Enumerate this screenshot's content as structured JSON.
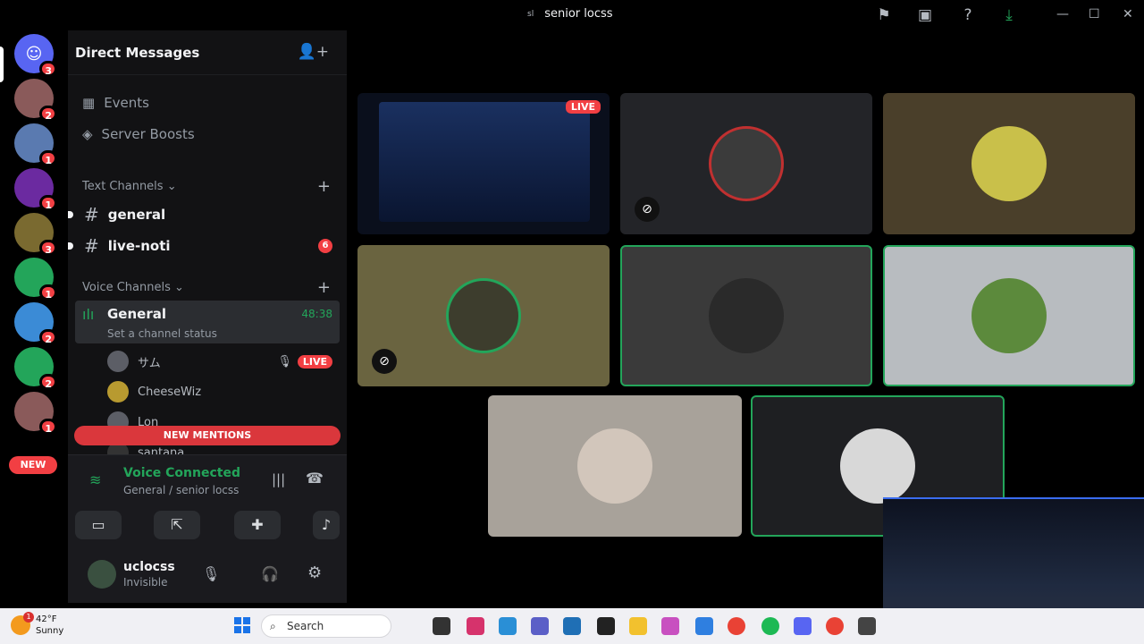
{
  "window": {
    "title": "senior locss",
    "server_abbrev": "sl",
    "minimize": "—",
    "maximize": "☐",
    "close": "✕"
  },
  "rail": {
    "dm_badge": "3",
    "servers": [
      {
        "badge": "2",
        "color": "#8a5a5a"
      },
      {
        "badge": "1",
        "color": "#5a7ab0"
      },
      {
        "badge": "1",
        "color": "#6b2aa0"
      },
      {
        "badge": "3",
        "color": "#7a6a30"
      },
      {
        "badge": "1",
        "color": "#23a55a"
      },
      {
        "badge": "2",
        "color": "#3b8bd6"
      },
      {
        "badge": "2",
        "color": "#23a55a"
      },
      {
        "badge": "1",
        "color": "#8a5a5a"
      }
    ],
    "new_label": "NEW"
  },
  "sidebar": {
    "header": "Direct Messages",
    "events": "Events",
    "boosts": "Server Boosts",
    "text_category": "Text Channels",
    "text_channels": [
      {
        "name": "general",
        "unread": ""
      },
      {
        "name": "live-noti",
        "unread": "6"
      }
    ],
    "voice_category": "Voice Channels",
    "voice_channel": {
      "name": "General",
      "time": "48:38",
      "status": "Set a channel status"
    },
    "voice_users": [
      {
        "name": "サム",
        "live": "LIVE"
      },
      {
        "name": "CheeseWiz",
        "live": ""
      },
      {
        "name": "Lon",
        "live": ""
      },
      {
        "name": "santana",
        "live": ""
      }
    ],
    "new_mentions": "NEW MENTIONS"
  },
  "voice_panel": {
    "status": "Voice Connected",
    "location": "General / senior locss"
  },
  "user": {
    "name": "uclocss",
    "status": "Invisible"
  },
  "stage": {
    "live_label": "LIVE"
  },
  "taskbar": {
    "temp": "42°F",
    "weather": "Sunny",
    "weather_badge": "1",
    "search": "Search"
  }
}
